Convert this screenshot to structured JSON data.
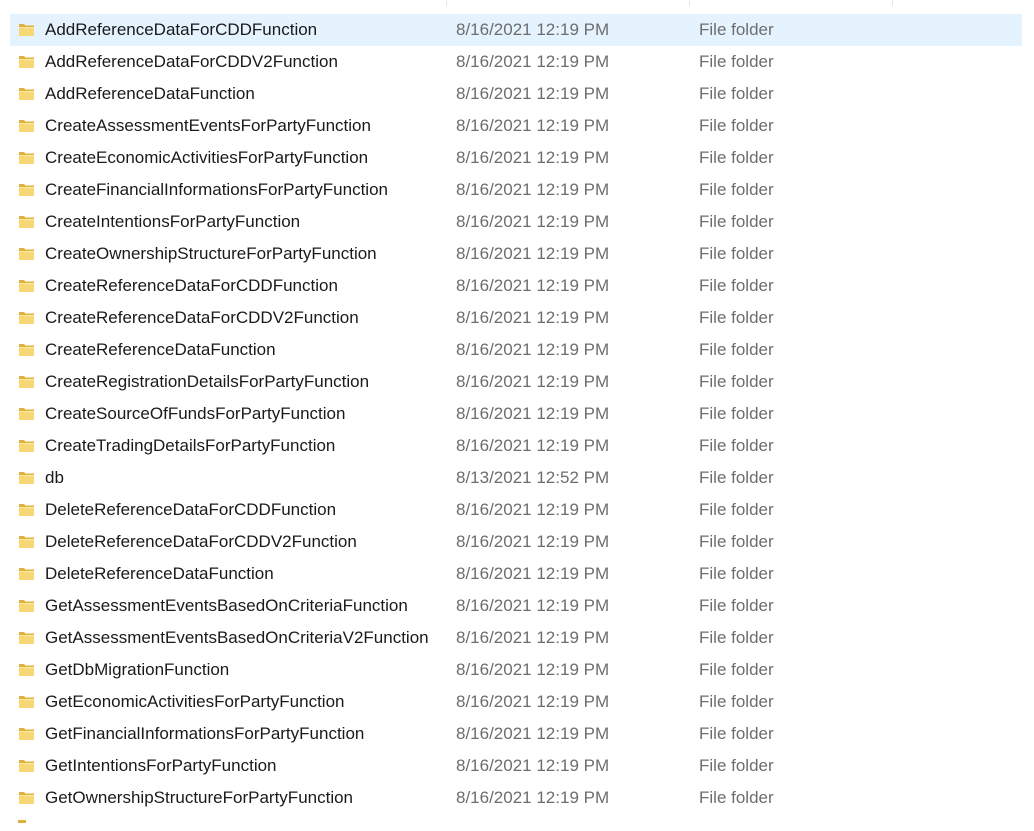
{
  "file_list": {
    "rows": [
      {
        "name": "AddReferenceDataForCDDFunction",
        "date": "8/16/2021 12:19 PM",
        "type": "File folder",
        "selected": true
      },
      {
        "name": "AddReferenceDataForCDDV2Function",
        "date": "8/16/2021 12:19 PM",
        "type": "File folder"
      },
      {
        "name": "AddReferenceDataFunction",
        "date": "8/16/2021 12:19 PM",
        "type": "File folder"
      },
      {
        "name": "CreateAssessmentEventsForPartyFunction",
        "date": "8/16/2021 12:19 PM",
        "type": "File folder"
      },
      {
        "name": "CreateEconomicActivitiesForPartyFunction",
        "date": "8/16/2021 12:19 PM",
        "type": "File folder"
      },
      {
        "name": "CreateFinancialInformationsForPartyFunction",
        "date": "8/16/2021 12:19 PM",
        "type": "File folder"
      },
      {
        "name": "CreateIntentionsForPartyFunction",
        "date": "8/16/2021 12:19 PM",
        "type": "File folder"
      },
      {
        "name": "CreateOwnershipStructureForPartyFunction",
        "date": "8/16/2021 12:19 PM",
        "type": "File folder"
      },
      {
        "name": "CreateReferenceDataForCDDFunction",
        "date": "8/16/2021 12:19 PM",
        "type": "File folder"
      },
      {
        "name": "CreateReferenceDataForCDDV2Function",
        "date": "8/16/2021 12:19 PM",
        "type": "File folder"
      },
      {
        "name": "CreateReferenceDataFunction",
        "date": "8/16/2021 12:19 PM",
        "type": "File folder"
      },
      {
        "name": "CreateRegistrationDetailsForPartyFunction",
        "date": "8/16/2021 12:19 PM",
        "type": "File folder"
      },
      {
        "name": "CreateSourceOfFundsForPartyFunction",
        "date": "8/16/2021 12:19 PM",
        "type": "File folder"
      },
      {
        "name": "CreateTradingDetailsForPartyFunction",
        "date": "8/16/2021 12:19 PM",
        "type": "File folder"
      },
      {
        "name": "db",
        "date": "8/13/2021 12:52 PM",
        "type": "File folder"
      },
      {
        "name": "DeleteReferenceDataForCDDFunction",
        "date": "8/16/2021 12:19 PM",
        "type": "File folder"
      },
      {
        "name": "DeleteReferenceDataForCDDV2Function",
        "date": "8/16/2021 12:19 PM",
        "type": "File folder"
      },
      {
        "name": "DeleteReferenceDataFunction",
        "date": "8/16/2021 12:19 PM",
        "type": "File folder"
      },
      {
        "name": "GetAssessmentEventsBasedOnCriteriaFunction",
        "date": "8/16/2021 12:19 PM",
        "type": "File folder"
      },
      {
        "name": "GetAssessmentEventsBasedOnCriteriaV2Function",
        "date": "8/16/2021 12:19 PM",
        "type": "File folder"
      },
      {
        "name": "GetDbMigrationFunction",
        "date": "8/16/2021 12:19 PM",
        "type": "File folder"
      },
      {
        "name": "GetEconomicActivitiesForPartyFunction",
        "date": "8/16/2021 12:19 PM",
        "type": "File folder"
      },
      {
        "name": "GetFinancialInformationsForPartyFunction",
        "date": "8/16/2021 12:19 PM",
        "type": "File folder"
      },
      {
        "name": "GetIntentionsForPartyFunction",
        "date": "8/16/2021 12:19 PM",
        "type": "File folder"
      },
      {
        "name": "GetOwnershipStructureForPartyFunction",
        "date": "8/16/2021 12:19 PM",
        "type": "File folder"
      }
    ]
  },
  "colors": {
    "selected_row_bg": "#e5f3ff",
    "folder_body": "#f8d775",
    "folder_back": "#e0b03c",
    "name_text": "#1a1a1a",
    "secondary_text": "#6d6d6d"
  },
  "icons": {
    "row_icon": "folder-icon"
  }
}
